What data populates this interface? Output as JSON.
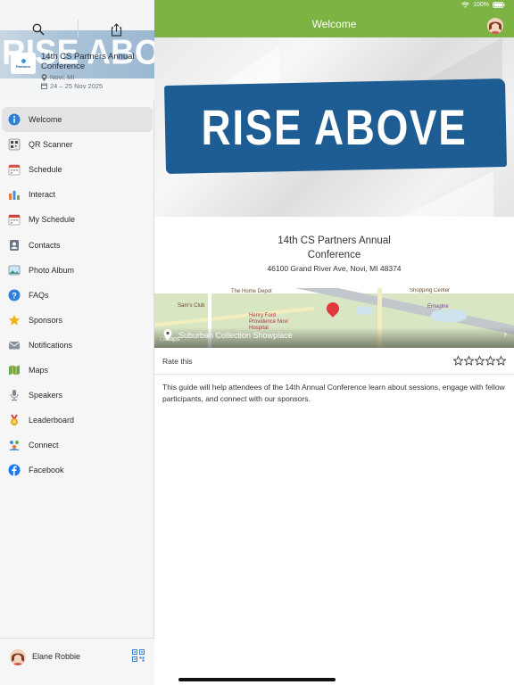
{
  "status": {
    "battery": "100%"
  },
  "sidebar": {
    "banner_text": "RISE ABOVE",
    "logo_text": "Partners",
    "event_title": "14th CS Partners Annual Conference",
    "location": "Novi, MI",
    "dates": "24 – 25 Nov 2025",
    "items": [
      {
        "label": "Welcome",
        "icon": "info-icon",
        "color": "#2f7fd8"
      },
      {
        "label": "QR Scanner",
        "icon": "qr-scanner-icon",
        "color": "#4a4a4a"
      },
      {
        "label": "Schedule",
        "icon": "calendar-icon",
        "color": "#e2554a"
      },
      {
        "label": "Interact",
        "icon": "interact-icon",
        "color": "#e87b2e"
      },
      {
        "label": "My Schedule",
        "icon": "my-schedule-icon",
        "color": "#d9443c"
      },
      {
        "label": "Contacts",
        "icon": "contacts-icon",
        "color": "#6b7785"
      },
      {
        "label": "Photo Album",
        "icon": "photo-album-icon",
        "color": "#3b9b7a"
      },
      {
        "label": "FAQs",
        "icon": "help-icon",
        "color": "#2f7fd8"
      },
      {
        "label": "Sponsors",
        "icon": "star-icon",
        "color": "#f2b21e"
      },
      {
        "label": "Notifications",
        "icon": "envelope-icon",
        "color": "#8a9099"
      },
      {
        "label": "Maps",
        "icon": "map-icon",
        "color": "#6aa84f"
      },
      {
        "label": "Speakers",
        "icon": "speaker-icon",
        "color": "#7d8894"
      },
      {
        "label": "Leaderboard",
        "icon": "medal-icon",
        "color": "#e5a823"
      },
      {
        "label": "Connect",
        "icon": "connect-icon",
        "color": "#3b8fd4"
      },
      {
        "label": "Facebook",
        "icon": "facebook-icon",
        "color": "#1877f2"
      }
    ],
    "user_name": "Elane Robbie"
  },
  "main": {
    "title": "Welcome",
    "hero_text": "RISE ABOVE",
    "event_name_line1": "14th CS Partners Annual",
    "event_name_line2": "Conference",
    "address": "46100 Grand River Ave, Novi, MI 48374",
    "map": {
      "place": "Suburban Collection Showplace",
      "credit": "Maps",
      "labels": {
        "home_depot": "The Home Depot",
        "sams_club": "Sam's Club",
        "shopping_center": "Shopping Center",
        "emagine": "Emagine",
        "hospital": "Henry Ford Providence Novi Hospital"
      }
    },
    "rate_label": "Rate this",
    "rating": 0,
    "rating_max": 5,
    "description": "This guide will help attendees of the 14th Annual Conference learn about sessions, engage with fellow participants, and connect with our sponsors."
  },
  "colors": {
    "accent": "#7cb342",
    "banner": "#1d5d93"
  }
}
